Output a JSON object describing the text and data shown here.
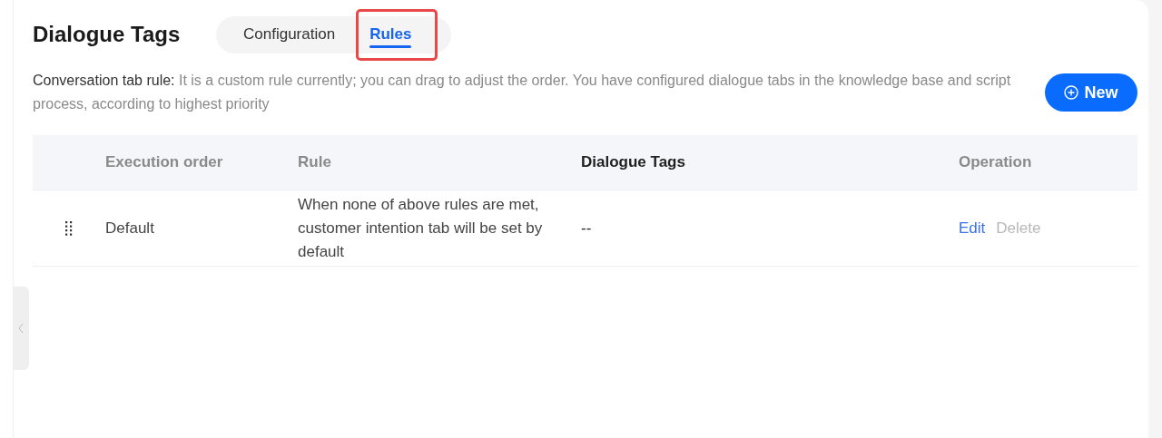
{
  "page_title": "Dialogue Tags",
  "tabs": [
    {
      "label": "Configuration",
      "selected": false,
      "highlighted": false
    },
    {
      "label": "Rules",
      "selected": true,
      "highlighted": true
    }
  ],
  "description": {
    "label": "Conversation tab rule:",
    "text": "It is a custom rule currently; you can drag to adjust the order. You have configured dialogue tabs in the knowledge base and script process, according to highest priority"
  },
  "new_button": {
    "label": "New"
  },
  "table": {
    "columns": [
      "Execution order",
      "Rule",
      "Dialogue Tags",
      "Operation"
    ],
    "rows": [
      {
        "order": "Default",
        "rule": "When none of above rules are met, customer intention tab will be set by default",
        "tags": "--",
        "actions": [
          {
            "label": "Edit",
            "disabled": false
          },
          {
            "label": "Delete",
            "disabled": true
          }
        ]
      }
    ]
  }
}
